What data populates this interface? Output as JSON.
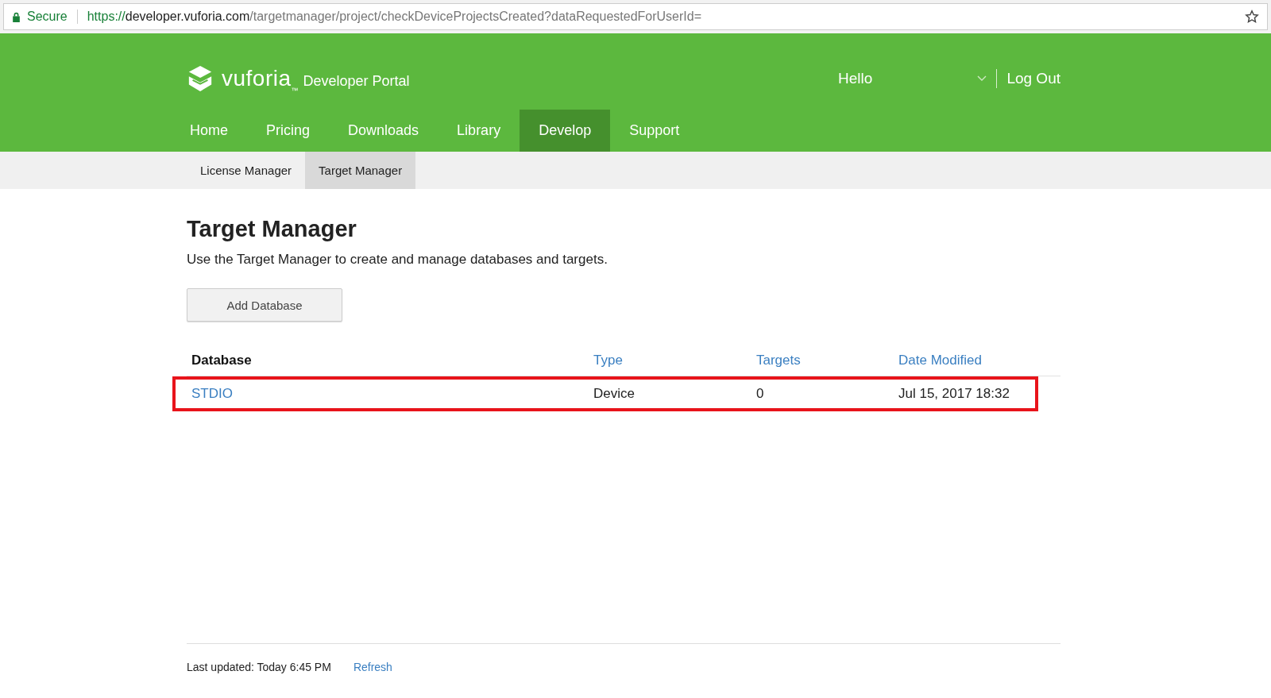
{
  "address_bar": {
    "security_label": "Secure",
    "url": {
      "scheme": "https://",
      "host": "developer.vuforia.com",
      "path": "/targetmanager/project/checkDeviceProjectsCreated?dataRequestedForUserId="
    }
  },
  "header": {
    "brand": "vuforia",
    "trademark": "™",
    "portal": "Developer Portal",
    "greeting": "Hello",
    "logout": "Log Out"
  },
  "nav": [
    {
      "label": "Home",
      "selected": false
    },
    {
      "label": "Pricing",
      "selected": false
    },
    {
      "label": "Downloads",
      "selected": false
    },
    {
      "label": "Library",
      "selected": false
    },
    {
      "label": "Develop",
      "selected": true
    },
    {
      "label": "Support",
      "selected": false
    }
  ],
  "subnav": [
    {
      "label": "License Manager",
      "selected": false
    },
    {
      "label": "Target Manager",
      "selected": true
    }
  ],
  "page": {
    "title": "Target Manager",
    "description": "Use the Target Manager to create and manage databases and targets.",
    "add_button": "Add Database"
  },
  "table": {
    "columns": [
      {
        "label": "Database",
        "sortable": false
      },
      {
        "label": "Type",
        "sortable": true
      },
      {
        "label": "Targets",
        "sortable": true
      },
      {
        "label": "Date Modified",
        "sortable": true
      }
    ],
    "rows": [
      {
        "name": "STDIO",
        "type": "Device",
        "targets": "0",
        "date_modified": "Jul 15, 2017 18:32",
        "highlighted": true
      }
    ]
  },
  "footer": {
    "last_updated": "Last updated: Today 6:45 PM",
    "refresh": "Refresh"
  }
}
